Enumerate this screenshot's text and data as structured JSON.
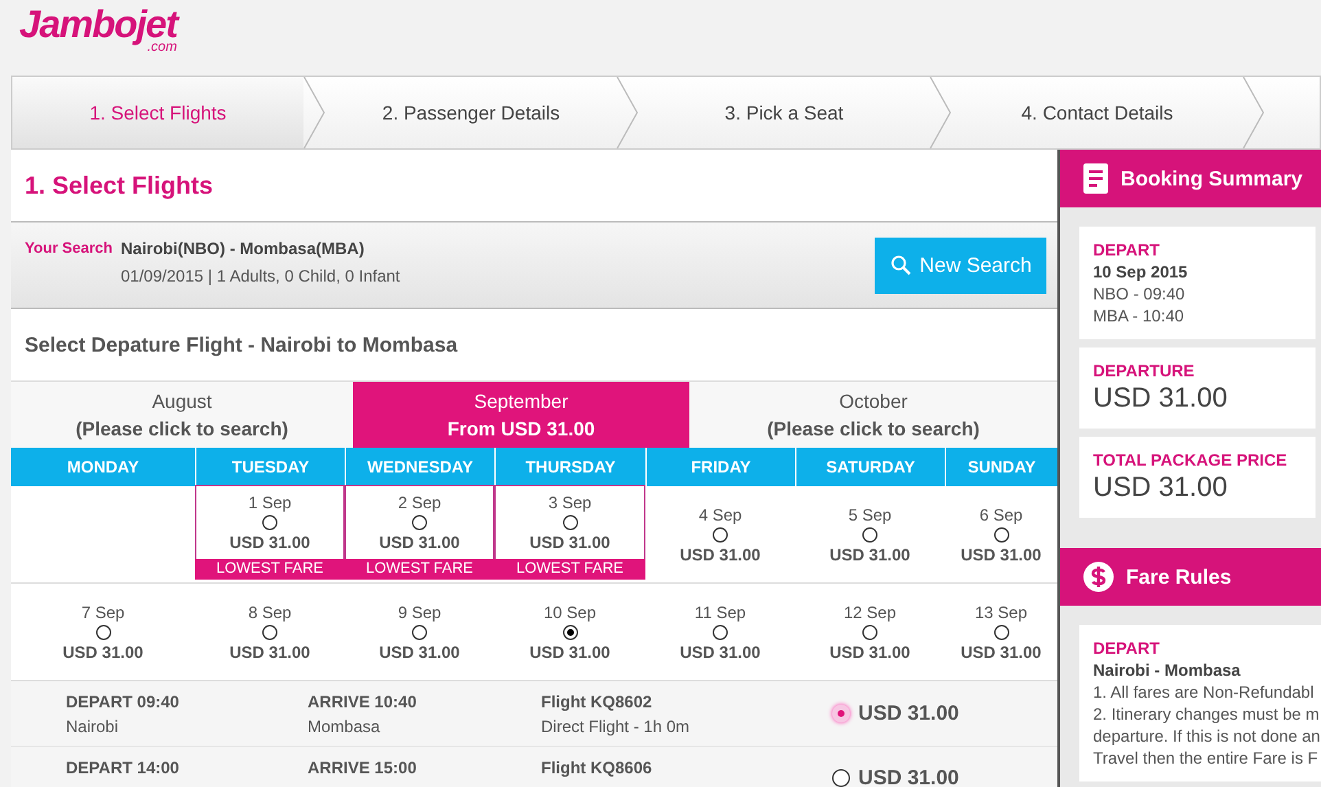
{
  "logo": {
    "name": "Jambojet",
    "domain": ".com"
  },
  "steps": [
    {
      "label": "1. Select Flights",
      "selected": true
    },
    {
      "label": "2. Passenger Details",
      "selected": false
    },
    {
      "label": "3. Pick a Seat",
      "selected": false
    },
    {
      "label": "4. Contact Details",
      "selected": false
    }
  ],
  "page_title": "1. Select Flights",
  "search": {
    "label": "Your Search",
    "route": "Nairobi(NBO) - Mombasa(MBA)",
    "details": "01/09/2015 |  1 Adults,  0 Child,  0 Infant",
    "button": "New Search"
  },
  "section_title": "Select Depature Flight - Nairobi to Mombasa",
  "months": [
    {
      "name": "August",
      "note": "(Please click to search)",
      "selected": false
    },
    {
      "name": "September",
      "note": "From USD 31.00",
      "selected": true
    },
    {
      "name": "October",
      "note": "(Please click to search)",
      "selected": false
    }
  ],
  "weekdays": [
    "MONDAY",
    "TUESDAY",
    "WEDNESDAY",
    "THURSDAY",
    "FRIDAY",
    "SATURDAY",
    "SUNDAY"
  ],
  "weeks": [
    [
      {
        "kind": "empty"
      },
      {
        "kind": "day",
        "date": "1 Sep",
        "price": "USD 31.00",
        "selected": false,
        "badge": "LOWEST FARE"
      },
      {
        "kind": "day",
        "date": "2 Sep",
        "price": "USD 31.00",
        "selected": false,
        "badge": "LOWEST FARE"
      },
      {
        "kind": "day",
        "date": "3 Sep",
        "price": "USD 31.00",
        "selected": false,
        "badge": "LOWEST FARE"
      },
      {
        "kind": "day",
        "date": "4 Sep",
        "price": "USD 31.00",
        "selected": false
      },
      {
        "kind": "day",
        "date": "5 Sep",
        "price": "USD 31.00",
        "selected": false
      },
      {
        "kind": "day",
        "date": "6 Sep",
        "price": "USD 31.00",
        "selected": false
      }
    ],
    [
      {
        "kind": "day",
        "date": "7 Sep",
        "price": "USD 31.00",
        "selected": false
      },
      {
        "kind": "day",
        "date": "8 Sep",
        "price": "USD 31.00",
        "selected": false
      },
      {
        "kind": "day",
        "date": "9 Sep",
        "price": "USD 31.00",
        "selected": false
      },
      {
        "kind": "day",
        "date": "10 Sep",
        "price": "USD 31.00",
        "selected": true
      },
      {
        "kind": "day",
        "date": "11 Sep",
        "price": "USD 31.00",
        "selected": false
      },
      {
        "kind": "day",
        "date": "12 Sep",
        "price": "USD 31.00",
        "selected": false
      },
      {
        "kind": "day",
        "date": "13 Sep",
        "price": "USD 31.00",
        "selected": false
      }
    ]
  ],
  "flights": [
    {
      "depart": "DEPART 09:40",
      "from": "Nairobi",
      "arrive": "ARRIVE 10:40",
      "to": "Mombasa",
      "flight": "Flight KQ8602",
      "duration": "Direct Flight - 1h 0m",
      "price": "USD 31.00",
      "selected": true
    },
    {
      "depart": "DEPART 14:00",
      "arrive": "ARRIVE 15:00",
      "flight": "Flight KQ8606",
      "price": "USD 31.00",
      "selected": false
    }
  ],
  "summary": {
    "title": "Booking Summary",
    "trip": {
      "label": "DEPART",
      "date": "10 Sep 2015",
      "lines": [
        "NBO - 09:40",
        "MBA - 10:40"
      ]
    },
    "prices": [
      {
        "label": "DEPARTURE",
        "amount": "USD  31.00"
      },
      {
        "label": "TOTAL PACKAGE PRICE",
        "amount": "USD  31.00"
      }
    ]
  },
  "fare_rules": {
    "title": "Fare Rules",
    "label": "DEPART",
    "route": "Nairobi - Mombasa",
    "lines": [
      "1. All fares are Non-Refundabl",
      "2. Itinerary changes must be m",
      "departure. If this is not done an",
      "Travel then the entire Fare is F"
    ]
  }
}
